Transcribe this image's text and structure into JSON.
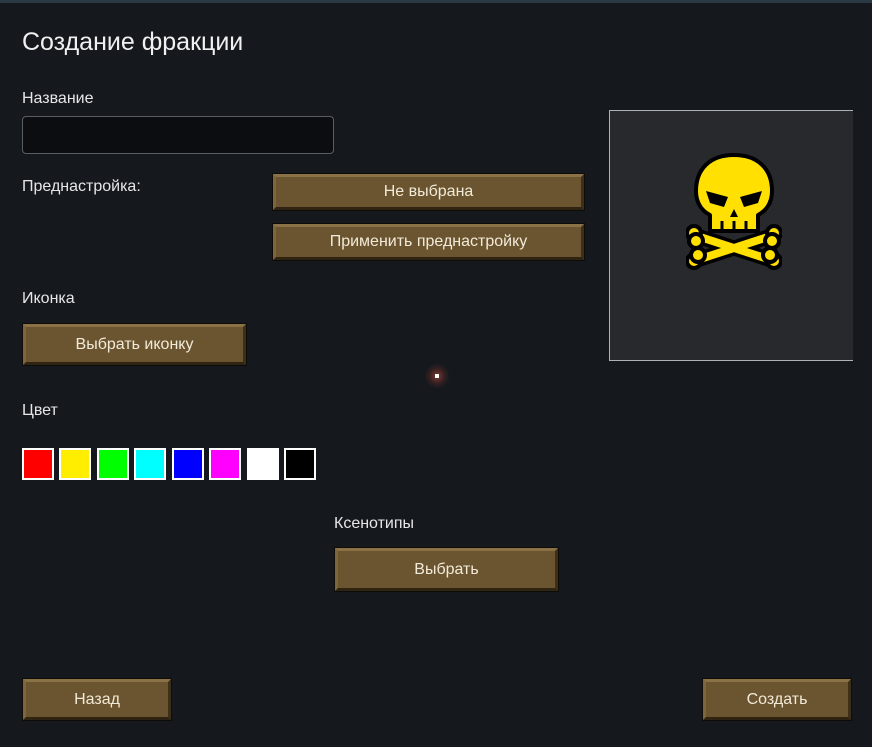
{
  "dialog": {
    "title": "Создание фракции"
  },
  "name_field": {
    "label": "Название",
    "value": "",
    "placeholder": ""
  },
  "preset": {
    "label": "Преднастройка:",
    "selected_label": "Не выбрана",
    "apply_label": "Применить преднастройку"
  },
  "icon_section": {
    "label": "Иконка",
    "choose_label": "Выбрать иконку",
    "preview_icon": "skull-crossbones-icon",
    "preview_color": "#ffe000"
  },
  "color_section": {
    "label": "Цвет",
    "swatches": [
      "#ff0000",
      "#ffee00",
      "#00ff00",
      "#00ffff",
      "#0000ff",
      "#ff00ff",
      "#ffffff",
      "#000000"
    ]
  },
  "xenotypes": {
    "label": "Ксенотипы",
    "choose_label": "Выбрать"
  },
  "footer": {
    "back_label": "Назад",
    "create_label": "Создать"
  }
}
